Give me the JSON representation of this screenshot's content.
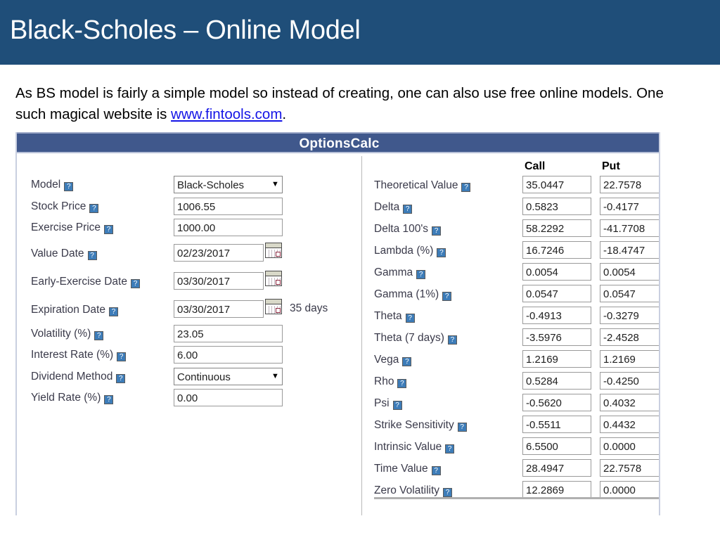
{
  "slide": {
    "title": "Black-Scholes – Online Model",
    "body_before": "As BS model is fairly a simple model so instead of creating, one can also use free online models. One such magical website is ",
    "body_link": "www.fintools.com",
    "body_after": "."
  },
  "colors": {
    "header_bar": "#1f4e79",
    "panel_titlebar": "#40588c",
    "link": "#1414e6",
    "help_icon": "#3d7cb8"
  },
  "calculator": {
    "title": "OptionsCalc",
    "help_glyph": "?",
    "select_arrow": "▼",
    "days_note": "35 days",
    "form": [
      {
        "label": "Model",
        "value": "Black-Scholes",
        "type": "select"
      },
      {
        "label": "Stock Price",
        "value": "1006.55",
        "type": "text"
      },
      {
        "label": "Exercise Price",
        "value": "1000.00",
        "type": "text"
      },
      {
        "label": "Value Date",
        "value": "02/23/2017",
        "type": "date"
      },
      {
        "label": "Early-Exercise Date",
        "value": "03/30/2017",
        "type": "date"
      },
      {
        "label": "Expiration Date",
        "value": "03/30/2017",
        "type": "date-note"
      },
      {
        "label": "Volatility (%)",
        "value": "23.05",
        "type": "text"
      },
      {
        "label": "Interest Rate (%)",
        "value": "6.00",
        "type": "text"
      },
      {
        "label": "Dividend Method",
        "value": "Continuous",
        "type": "select"
      },
      {
        "label": "Yield Rate (%)",
        "value": "0.00",
        "type": "text"
      }
    ],
    "results": {
      "col_call": "Call",
      "col_put": "Put",
      "rows": [
        {
          "label": "Theoretical Value",
          "call": "35.0447",
          "put": "22.7578"
        },
        {
          "label": "Delta",
          "call": "0.5823",
          "put": "-0.4177"
        },
        {
          "label": "Delta 100's",
          "call": "58.2292",
          "put": "-41.7708"
        },
        {
          "label": "Lambda (%)",
          "call": "16.7246",
          "put": "-18.4747"
        },
        {
          "label": "Gamma",
          "call": "0.0054",
          "put": "0.0054"
        },
        {
          "label": "Gamma (1%)",
          "call": "0.0547",
          "put": "0.0547"
        },
        {
          "label": "Theta",
          "call": "-0.4913",
          "put": "-0.3279"
        },
        {
          "label": "Theta (7 days)",
          "call": "-3.5976",
          "put": "-2.4528"
        },
        {
          "label": "Vega",
          "call": "1.2169",
          "put": "1.2169"
        },
        {
          "label": "Rho",
          "call": "0.5284",
          "put": "-0.4250"
        },
        {
          "label": "Psi",
          "call": "-0.5620",
          "put": "0.4032"
        },
        {
          "label": "Strike Sensitivity",
          "call": "-0.5511",
          "put": "0.4432"
        },
        {
          "label": "Intrinsic Value",
          "call": "6.5500",
          "put": "0.0000"
        },
        {
          "label": "Time Value",
          "call": "28.4947",
          "put": "22.7578"
        },
        {
          "label": "Zero Volatility",
          "call": "12.2869",
          "put": "0.0000"
        }
      ]
    }
  }
}
